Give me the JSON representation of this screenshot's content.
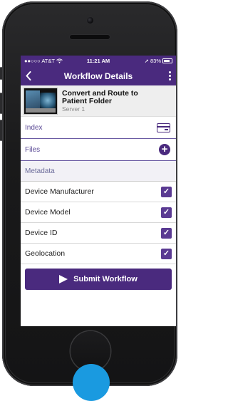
{
  "status_bar": {
    "carrier": "●●○○○ AT&T",
    "wifi_icon": "wifi-icon",
    "time": "11:21 AM",
    "location_arrow": "➚",
    "battery_percent": "83%"
  },
  "nav": {
    "back_icon": "chevron-left-icon",
    "title": "Workflow Details",
    "more_icon": "more-vertical-icon"
  },
  "workflow": {
    "title_line1": "Convert and Route to",
    "title_line2": "Patient Folder",
    "server": "Server 1"
  },
  "rows": {
    "index_label": "Index",
    "index_icon": "card-icon",
    "files_label": "Files",
    "files_icon": "plus-circle-icon"
  },
  "metadata": {
    "section_label": "Metadata",
    "items": [
      {
        "label": "Device Manufacturer",
        "checked": true
      },
      {
        "label": "Device Model",
        "checked": true
      },
      {
        "label": "Device ID",
        "checked": true
      },
      {
        "label": "Geolocation",
        "checked": true
      }
    ],
    "check_glyph": "✓"
  },
  "submit": {
    "label": "Submit Workflow",
    "icon": "send-icon"
  },
  "colors": {
    "primary": "#4a2a7e",
    "section_bg": "#f2f1f6",
    "touch_indicator": "#1a9ae0"
  }
}
